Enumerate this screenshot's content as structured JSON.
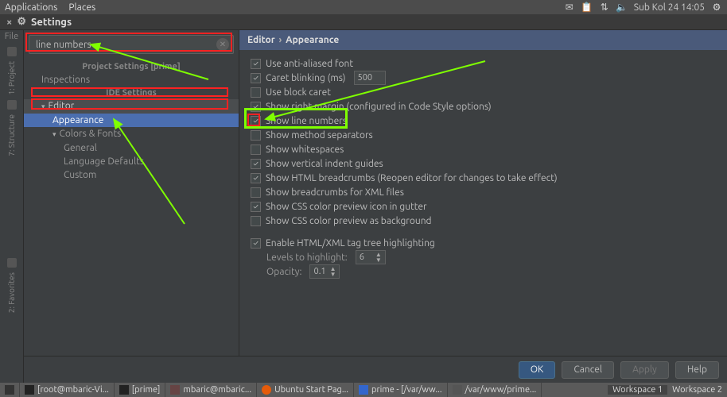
{
  "menubar": {
    "items": [
      "Applications",
      "Places"
    ],
    "clock": "Sub Kol 24  14:05"
  },
  "tab": {
    "title": "Settings"
  },
  "left_strip": {
    "file": "File",
    "project": "1: Project",
    "structure": "7: Structure",
    "favorites": "2: Favorites"
  },
  "search": {
    "value": "line numbers"
  },
  "tree": {
    "header1": "Project Settings [prime]",
    "inspections": "Inspections",
    "header2": "IDE Settings",
    "editor": "Editor",
    "appearance": "Appearance",
    "colors_fonts": "Colors & Fonts",
    "general": "General",
    "lang_defaults": "Language Defaults",
    "custom": "Custom"
  },
  "breadcrumb": {
    "a": "Editor",
    "b": "Appearance"
  },
  "opts": {
    "anti_aliased": "Use anti-aliased font",
    "caret_blink": "Caret blinking (ms)",
    "caret_blink_val": "500",
    "block_caret": "Use block caret",
    "right_margin": "Show right margin (configured in Code Style options)",
    "line_numbers": "Show line numbers",
    "method_sep": "Show method separators",
    "whitespaces": "Show whitespaces",
    "indent_guides": "Show vertical indent guides",
    "html_bc": "Show HTML breadcrumbs (Reopen editor for changes to take effect)",
    "xml_bc": "Show breadcrumbs for XML files",
    "css_gutter": "Show CSS color preview icon in gutter",
    "css_bg": "Show CSS color preview as background",
    "tag_tree": "Enable HTML/XML tag tree highlighting",
    "levels": "Levels to highlight:",
    "levels_val": "6",
    "opacity": "Opacity:",
    "opacity_val": "0.1"
  },
  "footer": {
    "ok": "OK",
    "cancel": "Cancel",
    "apply": "Apply",
    "help": "Help"
  },
  "taskbar": {
    "t1": "[root@mbaric-Vi...",
    "t2": "[prime]",
    "t3": "mbaric@mbaric...",
    "t4": "Ubuntu Start Pag...",
    "t5": "prime - [/var/ww...",
    "t6": "/var/www/prime...",
    "ws1": "Workspace 1",
    "ws2": "Workspace 2"
  }
}
